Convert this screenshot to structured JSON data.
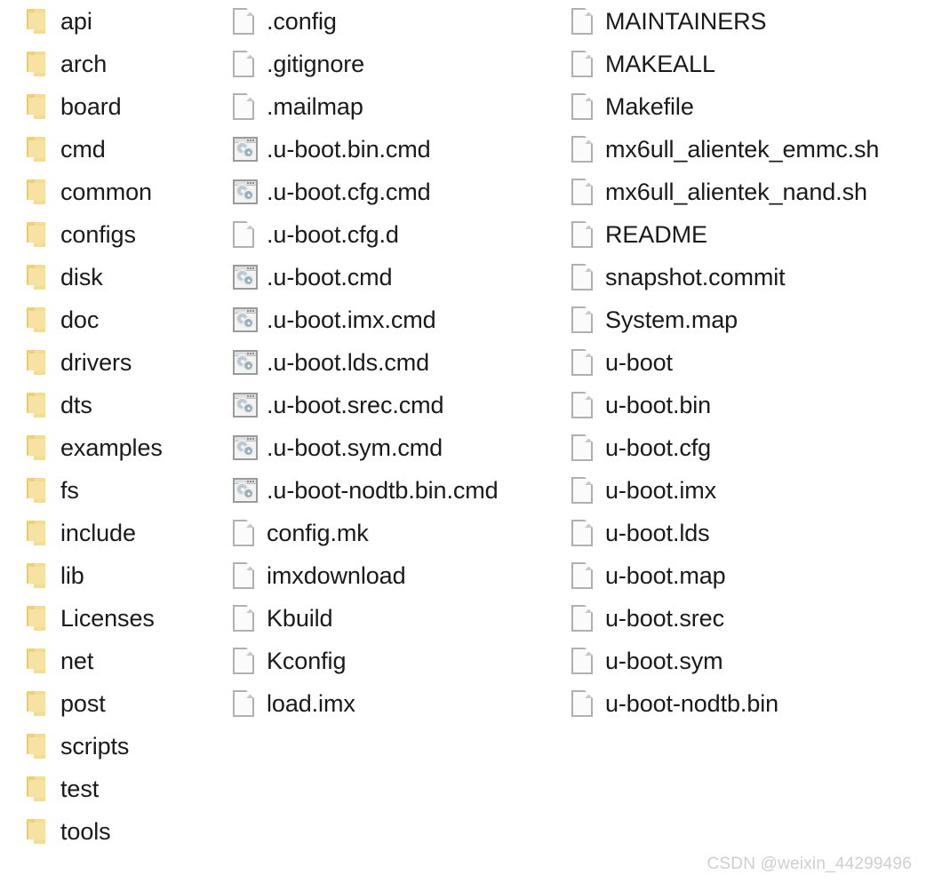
{
  "view": {
    "kind": "file-explorer-listing",
    "layout": "three-column-list",
    "background_color": "#ffffff",
    "text_color": "#1a1a1a",
    "folder_icon_color": "#f4dc90",
    "file_icon_color": "#b0b0b0"
  },
  "watermark": {
    "text": "CSDN @weixin_44299496",
    "color": "#cfcfcf"
  },
  "columns": [
    {
      "name": "column-1-folders",
      "items": [
        {
          "label": "api",
          "icon": "folder-icon",
          "type": "folder"
        },
        {
          "label": "arch",
          "icon": "folder-icon",
          "type": "folder"
        },
        {
          "label": "board",
          "icon": "folder-icon",
          "type": "folder"
        },
        {
          "label": "cmd",
          "icon": "folder-icon",
          "type": "folder"
        },
        {
          "label": "common",
          "icon": "folder-icon",
          "type": "folder"
        },
        {
          "label": "configs",
          "icon": "folder-icon",
          "type": "folder"
        },
        {
          "label": "disk",
          "icon": "folder-icon",
          "type": "folder"
        },
        {
          "label": "doc",
          "icon": "folder-icon",
          "type": "folder"
        },
        {
          "label": "drivers",
          "icon": "folder-icon",
          "type": "folder"
        },
        {
          "label": "dts",
          "icon": "folder-icon",
          "type": "folder"
        },
        {
          "label": "examples",
          "icon": "folder-icon",
          "type": "folder"
        },
        {
          "label": "fs",
          "icon": "folder-icon",
          "type": "folder"
        },
        {
          "label": "include",
          "icon": "folder-icon",
          "type": "folder"
        },
        {
          "label": "lib",
          "icon": "folder-icon",
          "type": "folder"
        },
        {
          "label": "Licenses",
          "icon": "folder-icon",
          "type": "folder"
        },
        {
          "label": "net",
          "icon": "folder-icon",
          "type": "folder"
        },
        {
          "label": "post",
          "icon": "folder-icon",
          "type": "folder"
        },
        {
          "label": "scripts",
          "icon": "folder-icon",
          "type": "folder"
        },
        {
          "label": "test",
          "icon": "folder-icon",
          "type": "folder"
        },
        {
          "label": "tools",
          "icon": "folder-icon",
          "type": "folder"
        }
      ]
    },
    {
      "name": "column-2-files",
      "items": [
        {
          "label": ".config",
          "icon": "file-icon",
          "type": "file"
        },
        {
          "label": ".gitignore",
          "icon": "file-icon",
          "type": "file"
        },
        {
          "label": ".mailmap",
          "icon": "file-icon",
          "type": "file"
        },
        {
          "label": ".u-boot.bin.cmd",
          "icon": "cmd-script-icon",
          "type": "cmd"
        },
        {
          "label": ".u-boot.cfg.cmd",
          "icon": "cmd-script-icon",
          "type": "cmd"
        },
        {
          "label": ".u-boot.cfg.d",
          "icon": "file-icon",
          "type": "file"
        },
        {
          "label": ".u-boot.cmd",
          "icon": "cmd-script-icon",
          "type": "cmd"
        },
        {
          "label": ".u-boot.imx.cmd",
          "icon": "cmd-script-icon",
          "type": "cmd"
        },
        {
          "label": ".u-boot.lds.cmd",
          "icon": "cmd-script-icon",
          "type": "cmd"
        },
        {
          "label": ".u-boot.srec.cmd",
          "icon": "cmd-script-icon",
          "type": "cmd"
        },
        {
          "label": ".u-boot.sym.cmd",
          "icon": "cmd-script-icon",
          "type": "cmd"
        },
        {
          "label": ".u-boot-nodtb.bin.cmd",
          "icon": "cmd-script-icon",
          "type": "cmd"
        },
        {
          "label": "config.mk",
          "icon": "file-icon",
          "type": "file"
        },
        {
          "label": "imxdownload",
          "icon": "file-icon",
          "type": "file"
        },
        {
          "label": "Kbuild",
          "icon": "file-icon",
          "type": "file"
        },
        {
          "label": "Kconfig",
          "icon": "file-icon",
          "type": "file"
        },
        {
          "label": "load.imx",
          "icon": "file-icon",
          "type": "file"
        }
      ]
    },
    {
      "name": "column-3-files",
      "items": [
        {
          "label": "MAINTAINERS",
          "icon": "file-icon",
          "type": "file"
        },
        {
          "label": "MAKEALL",
          "icon": "file-icon",
          "type": "file"
        },
        {
          "label": "Makefile",
          "icon": "file-icon",
          "type": "file"
        },
        {
          "label": "mx6ull_alientek_emmc.sh",
          "icon": "file-icon",
          "type": "file"
        },
        {
          "label": "mx6ull_alientek_nand.sh",
          "icon": "file-icon",
          "type": "file"
        },
        {
          "label": "README",
          "icon": "file-icon",
          "type": "file"
        },
        {
          "label": "snapshot.commit",
          "icon": "file-icon",
          "type": "file"
        },
        {
          "label": "System.map",
          "icon": "file-icon",
          "type": "file"
        },
        {
          "label": "u-boot",
          "icon": "file-icon",
          "type": "file"
        },
        {
          "label": "u-boot.bin",
          "icon": "file-icon",
          "type": "file"
        },
        {
          "label": "u-boot.cfg",
          "icon": "file-icon",
          "type": "file"
        },
        {
          "label": "u-boot.imx",
          "icon": "file-icon",
          "type": "file"
        },
        {
          "label": "u-boot.lds",
          "icon": "file-icon",
          "type": "file"
        },
        {
          "label": "u-boot.map",
          "icon": "file-icon",
          "type": "file"
        },
        {
          "label": "u-boot.srec",
          "icon": "file-icon",
          "type": "file"
        },
        {
          "label": "u-boot.sym",
          "icon": "file-icon",
          "type": "file"
        },
        {
          "label": "u-boot-nodtb.bin",
          "icon": "file-icon",
          "type": "file"
        }
      ]
    }
  ]
}
